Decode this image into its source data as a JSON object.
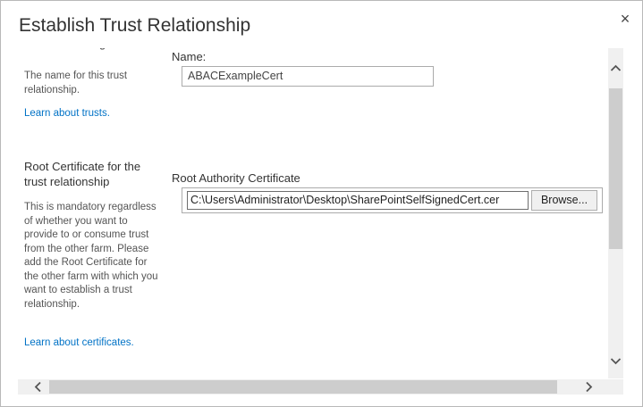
{
  "dialog": {
    "title": "Establish Trust Relationship",
    "close_glyph": "×"
  },
  "name_section": {
    "cut_heading": "g",
    "description": "The name for this trust relationship.",
    "link": "Learn about trusts.",
    "field_label": "Name:",
    "value": "ABACExampleCert"
  },
  "certificate_section": {
    "title": "Root Certificate for the trust relationship",
    "description": "This is mandatory regardless of whether you want to provide to or consume trust from the other farm. Please add the Root Certificate for the other farm with which you want to establish a trust relationship.",
    "link": "Learn about certificates.",
    "field_label": "Root Authority Certificate",
    "file_path": "C:\\Users\\Administrator\\Desktop\\SharePointSelfSignedCert.cer",
    "browse_label": "Browse..."
  },
  "icons": {
    "close": "close-icon",
    "scroll_up": "chevron-up-icon",
    "scroll_down": "chevron-down-icon",
    "scroll_left": "chevron-left-icon",
    "scroll_right": "chevron-right-icon"
  }
}
